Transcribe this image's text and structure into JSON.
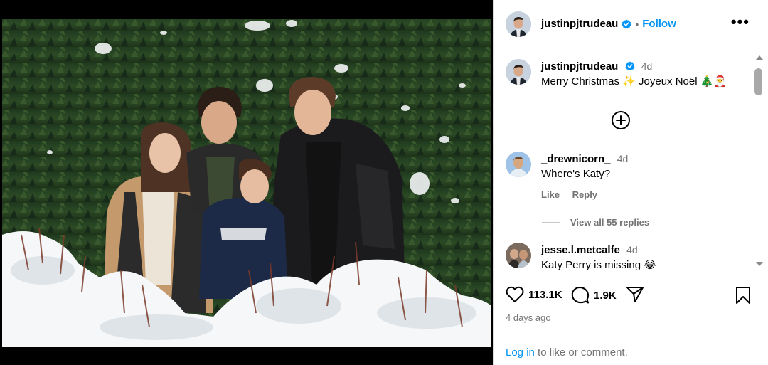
{
  "post": {
    "username": "justinpjtrudeau",
    "follow_label": "Follow",
    "separator": "•",
    "more_label": "•••"
  },
  "caption": {
    "username": "justinpjtrudeau",
    "time": "4d",
    "text": "Merry Christmas ✨ Joyeux Noël 🎄🎅"
  },
  "comments": [
    {
      "username": "_drewnicorn_",
      "time": "4d",
      "text": "Where's Katy?",
      "like_label": "Like",
      "reply_label": "Reply",
      "view_replies": "View all 55 replies"
    },
    {
      "username": "jesse.l.metcalfe",
      "time": "4d",
      "text": "Katy Perry is missing 😂"
    }
  ],
  "stats": {
    "likes": "113.1K",
    "comments": "1.9K",
    "time_ago": "4 days ago"
  },
  "login": {
    "link": "Log in",
    "rest": " to like or comment."
  },
  "icons": {
    "like": "heart-icon",
    "comment": "comment-bubble-icon",
    "share": "paper-plane-icon",
    "save": "bookmark-icon",
    "add": "add-circle-icon",
    "verified": "verified-badge-icon"
  },
  "colors": {
    "link": "#0095f6",
    "verified": "#0095f6",
    "muted": "#737373"
  }
}
